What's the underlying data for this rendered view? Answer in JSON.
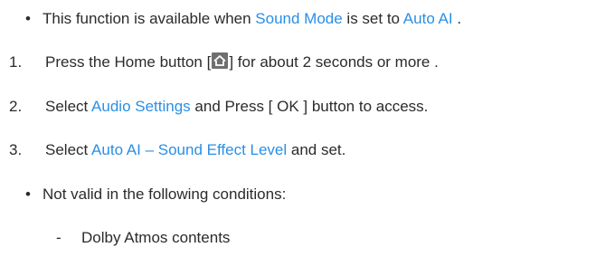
{
  "items": [
    {
      "marker": "•",
      "parts": [
        {
          "text": "This function is available when ",
          "hl": false
        },
        {
          "text": "Sound Mode",
          "hl": true
        },
        {
          "text": " is set to ",
          "hl": false
        },
        {
          "text": "Auto AI",
          "hl": true
        },
        {
          "text": " .",
          "hl": false
        }
      ]
    },
    {
      "marker": "1.",
      "pre": "Press the Home button [",
      "icon": "home-icon",
      "post": "] for about 2 seconds or more ."
    },
    {
      "marker": "2.",
      "parts": [
        {
          "text": "Select ",
          "hl": false
        },
        {
          "text": "Audio Settings",
          "hl": true
        },
        {
          "text": " and Press [ OK ] button to access.",
          "hl": false
        }
      ]
    },
    {
      "marker": "3.",
      "parts": [
        {
          "text": "Select ",
          "hl": false
        },
        {
          "text": "Auto AI – Sound Effect Level",
          "hl": true
        },
        {
          "text": " and set.",
          "hl": false
        }
      ]
    },
    {
      "marker": "•",
      "text": "Not valid in the following conditions:"
    },
    {
      "marker": "-",
      "text": "Dolby Atmos contents"
    }
  ],
  "colors": {
    "text": "#2b2b2b",
    "highlight": "#2a8fe6",
    "icon_bg": "#6f6f6f"
  }
}
